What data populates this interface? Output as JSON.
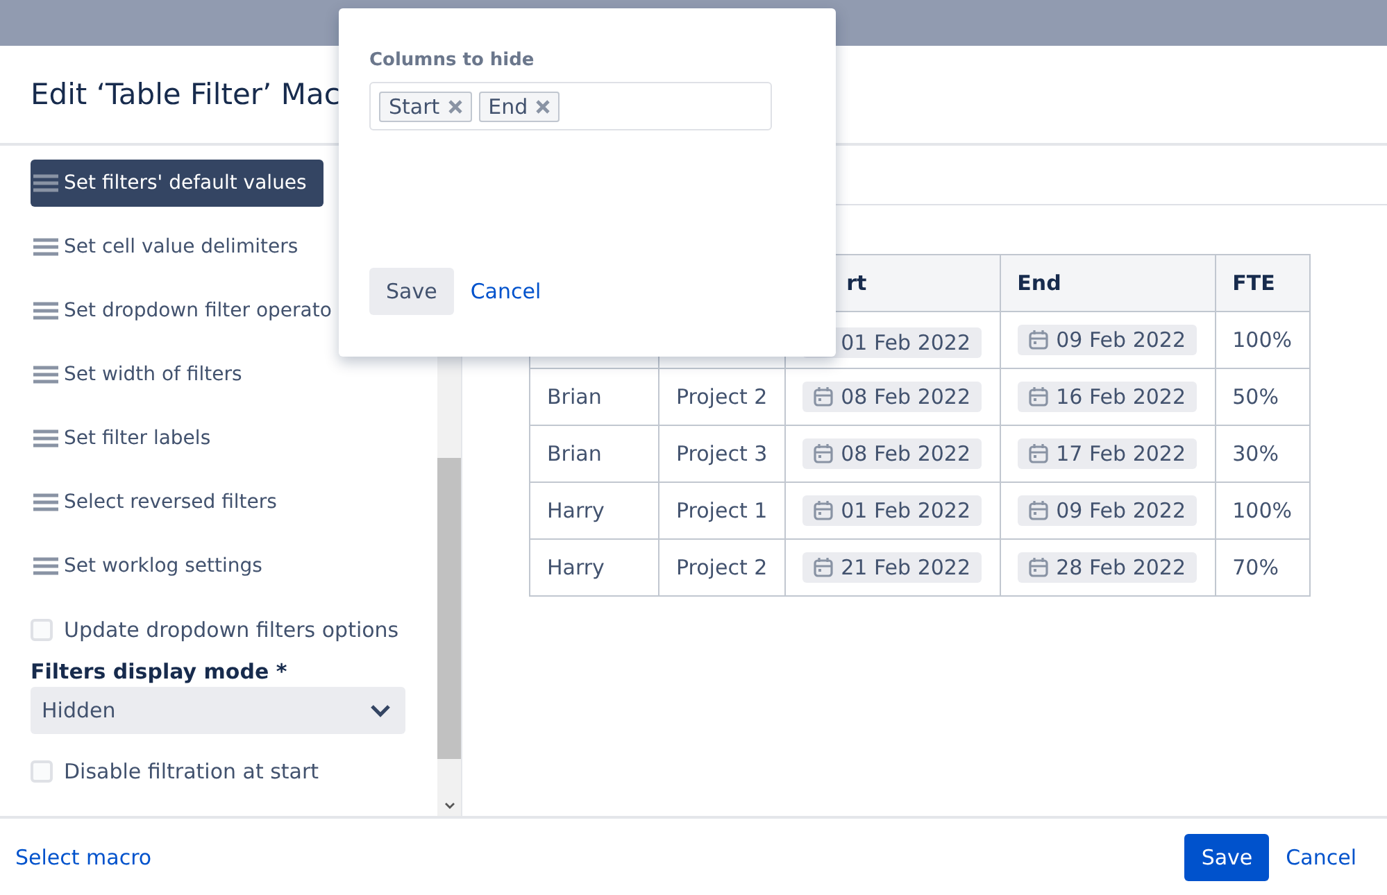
{
  "dialog": {
    "title": "Edit ‘Table Filter’ Mac"
  },
  "sidebar": {
    "items": [
      {
        "kind": "menu",
        "label": "Set filters' default values",
        "selected": true
      },
      {
        "kind": "menu",
        "label": "Set cell value delimiters",
        "selected": false
      },
      {
        "kind": "menu",
        "label": "Set dropdown filter operato",
        "selected": false
      },
      {
        "kind": "menu",
        "label": "Set width of filters",
        "selected": false
      },
      {
        "kind": "menu",
        "label": "Set filter labels",
        "selected": false
      },
      {
        "kind": "menu",
        "label": "Select reversed filters",
        "selected": false
      },
      {
        "kind": "menu",
        "label": "Set worklog settings",
        "selected": false
      },
      {
        "kind": "checkbox",
        "label": "Update dropdown filters options",
        "checked": false
      },
      {
        "kind": "select",
        "label": "Filters display mode *",
        "value": "Hidden"
      },
      {
        "kind": "checkbox",
        "label": "Disable filtration at start",
        "checked": false
      }
    ]
  },
  "table": {
    "columns": [
      {},
      {},
      {
        "label": "rt"
      },
      {
        "label": "End"
      },
      {
        "label": "FTE"
      }
    ],
    "rows": [
      {
        "start": "01 Feb 2022",
        "end": "09 Feb 2022",
        "fte": "100%"
      },
      {
        "name": "Brian",
        "project": "Project 2",
        "start": "08 Feb 2022",
        "end": "16 Feb 2022",
        "fte": "50%"
      },
      {
        "name": "Brian",
        "project": "Project 3",
        "start": "08 Feb 2022",
        "end": "17 Feb 2022",
        "fte": "30%"
      },
      {
        "name": "Harry",
        "project": "Project 1",
        "start": "01 Feb 2022",
        "end": "09 Feb 2022",
        "fte": "100%"
      },
      {
        "name": "Harry",
        "project": "Project 2",
        "start": "21 Feb 2022",
        "end": "28 Feb 2022",
        "fte": "70%"
      }
    ]
  },
  "popover": {
    "label": "Columns to hide",
    "tags": [
      "Start",
      "End"
    ],
    "save": "Save",
    "cancel": "Cancel"
  },
  "footer": {
    "link": "Select macro",
    "save": "Save",
    "cancel": "Cancel"
  }
}
